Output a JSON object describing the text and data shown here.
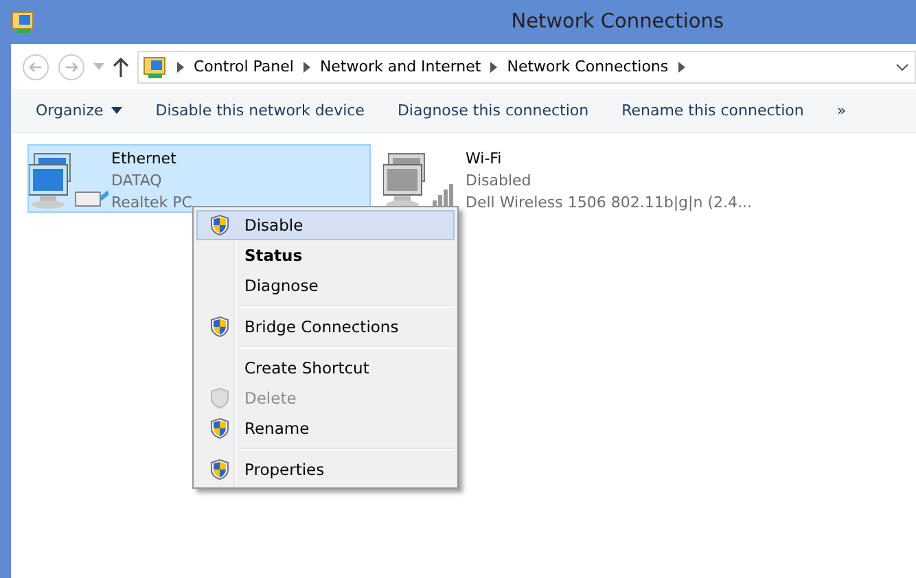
{
  "window": {
    "title": "Network Connections"
  },
  "address": {
    "segments": [
      "Control Panel",
      "Network and Internet",
      "Network Connections"
    ]
  },
  "toolbar": {
    "items": [
      {
        "label": "Organize",
        "dropdown": true
      },
      {
        "label": "Disable this network device",
        "dropdown": false
      },
      {
        "label": "Diagnose this connection",
        "dropdown": false
      },
      {
        "label": "Rename this connection",
        "dropdown": false
      },
      {
        "label": "»",
        "dropdown": false
      }
    ]
  },
  "connections": [
    {
      "name": "Ethernet",
      "status": "DATAQ",
      "device": "Realtek PC",
      "kind": "wired",
      "selected": true
    },
    {
      "name": "Wi-Fi",
      "status": "Disabled",
      "device": "Dell Wireless 1506 802.11b|g|n (2.4...",
      "kind": "wireless",
      "selected": false
    }
  ],
  "context_menu": [
    {
      "kind": "item",
      "label": "Disable",
      "shield": true,
      "selected": true,
      "default": false,
      "disabled": false
    },
    {
      "kind": "item",
      "label": "Status",
      "shield": false,
      "selected": false,
      "default": true,
      "disabled": false
    },
    {
      "kind": "item",
      "label": "Diagnose",
      "shield": false,
      "selected": false,
      "default": false,
      "disabled": false
    },
    {
      "kind": "separator"
    },
    {
      "kind": "item",
      "label": "Bridge Connections",
      "shield": true,
      "selected": false,
      "default": false,
      "disabled": false
    },
    {
      "kind": "separator"
    },
    {
      "kind": "item",
      "label": "Create Shortcut",
      "shield": false,
      "selected": false,
      "default": false,
      "disabled": false
    },
    {
      "kind": "item",
      "label": "Delete",
      "shield": true,
      "selected": false,
      "default": false,
      "disabled": true
    },
    {
      "kind": "item",
      "label": "Rename",
      "shield": true,
      "selected": false,
      "default": false,
      "disabled": false
    },
    {
      "kind": "separator"
    },
    {
      "kind": "item",
      "label": "Properties",
      "shield": true,
      "selected": false,
      "default": false,
      "disabled": false
    }
  ]
}
